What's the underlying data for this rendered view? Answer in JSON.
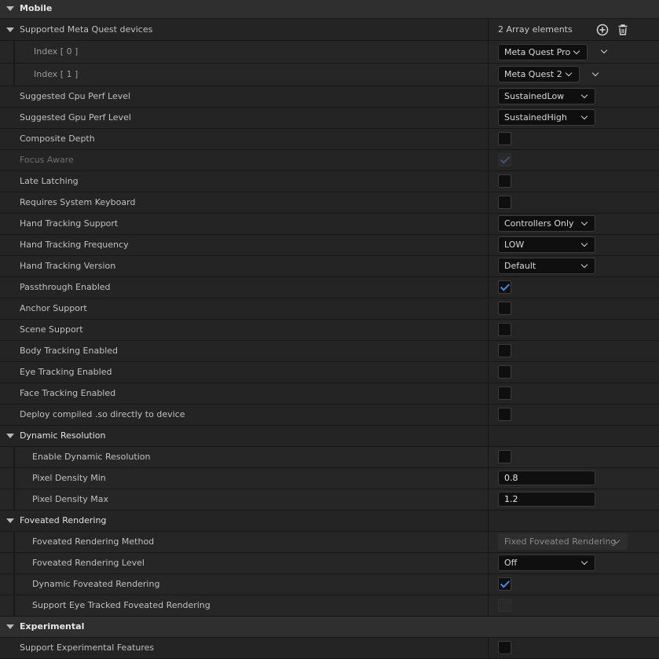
{
  "sections": {
    "mobile": "Mobile",
    "dynamic_resolution": "Dynamic Resolution",
    "foveated_rendering": "Foveated Rendering",
    "experimental": "Experimental"
  },
  "supported_devices": {
    "label": "Supported Meta Quest devices",
    "summary": "2 Array elements",
    "items": [
      {
        "index_label": "Index [ 0 ]",
        "value": "Meta Quest Pro"
      },
      {
        "index_label": "Index [ 1 ]",
        "value": "Meta Quest 2"
      }
    ]
  },
  "props": {
    "cpu_perf": {
      "label": "Suggested Cpu Perf Level",
      "value": "SustainedLow"
    },
    "gpu_perf": {
      "label": "Suggested Gpu Perf Level",
      "value": "SustainedHigh"
    },
    "composite_depth": {
      "label": "Composite Depth",
      "checked": false
    },
    "focus_aware": {
      "label": "Focus Aware",
      "checked": true
    },
    "late_latching": {
      "label": "Late Latching",
      "checked": false
    },
    "system_keyboard": {
      "label": "Requires System Keyboard",
      "checked": false
    },
    "hand_tracking_support": {
      "label": "Hand Tracking Support",
      "value": "Controllers Only"
    },
    "hand_tracking_frequency": {
      "label": "Hand Tracking Frequency",
      "value": "LOW"
    },
    "hand_tracking_version": {
      "label": "Hand Tracking Version",
      "value": "Default"
    },
    "passthrough": {
      "label": "Passthrough Enabled",
      "checked": true
    },
    "anchor_support": {
      "label": "Anchor Support",
      "checked": false
    },
    "scene_support": {
      "label": "Scene Support",
      "checked": false
    },
    "body_tracking": {
      "label": "Body Tracking Enabled",
      "checked": false
    },
    "eye_tracking": {
      "label": "Eye Tracking Enabled",
      "checked": false
    },
    "face_tracking": {
      "label": "Face Tracking Enabled",
      "checked": false
    },
    "deploy_so": {
      "label": "Deploy compiled .so directly to device",
      "checked": false
    },
    "enable_dynamic_resolution": {
      "label": "Enable Dynamic Resolution",
      "checked": false
    },
    "pixel_density_min": {
      "label": "Pixel Density Min",
      "value": "0.8"
    },
    "pixel_density_max": {
      "label": "Pixel Density Max",
      "value": "1.2"
    },
    "foveated_method": {
      "label": "Foveated Rendering Method",
      "value": "Fixed Foveated Rendering"
    },
    "foveated_level": {
      "label": "Foveated Rendering Level",
      "value": "Off"
    },
    "dynamic_foveated": {
      "label": "Dynamic Foveated Rendering",
      "checked": true
    },
    "eye_tracked_foveated": {
      "label": "Support Eye Tracked Foveated Rendering",
      "checked": false
    },
    "experimental_features": {
      "label": "Support Experimental Features",
      "checked": false
    }
  },
  "icons": {
    "add": "plus-circle-icon",
    "delete": "trash-icon",
    "expand": "triangle-down-icon"
  },
  "colors": {
    "accent": "#3d8cf0",
    "panel_bg": "#242424",
    "category_bg": "#2f2f2f",
    "input_bg": "#0f0f0f"
  }
}
